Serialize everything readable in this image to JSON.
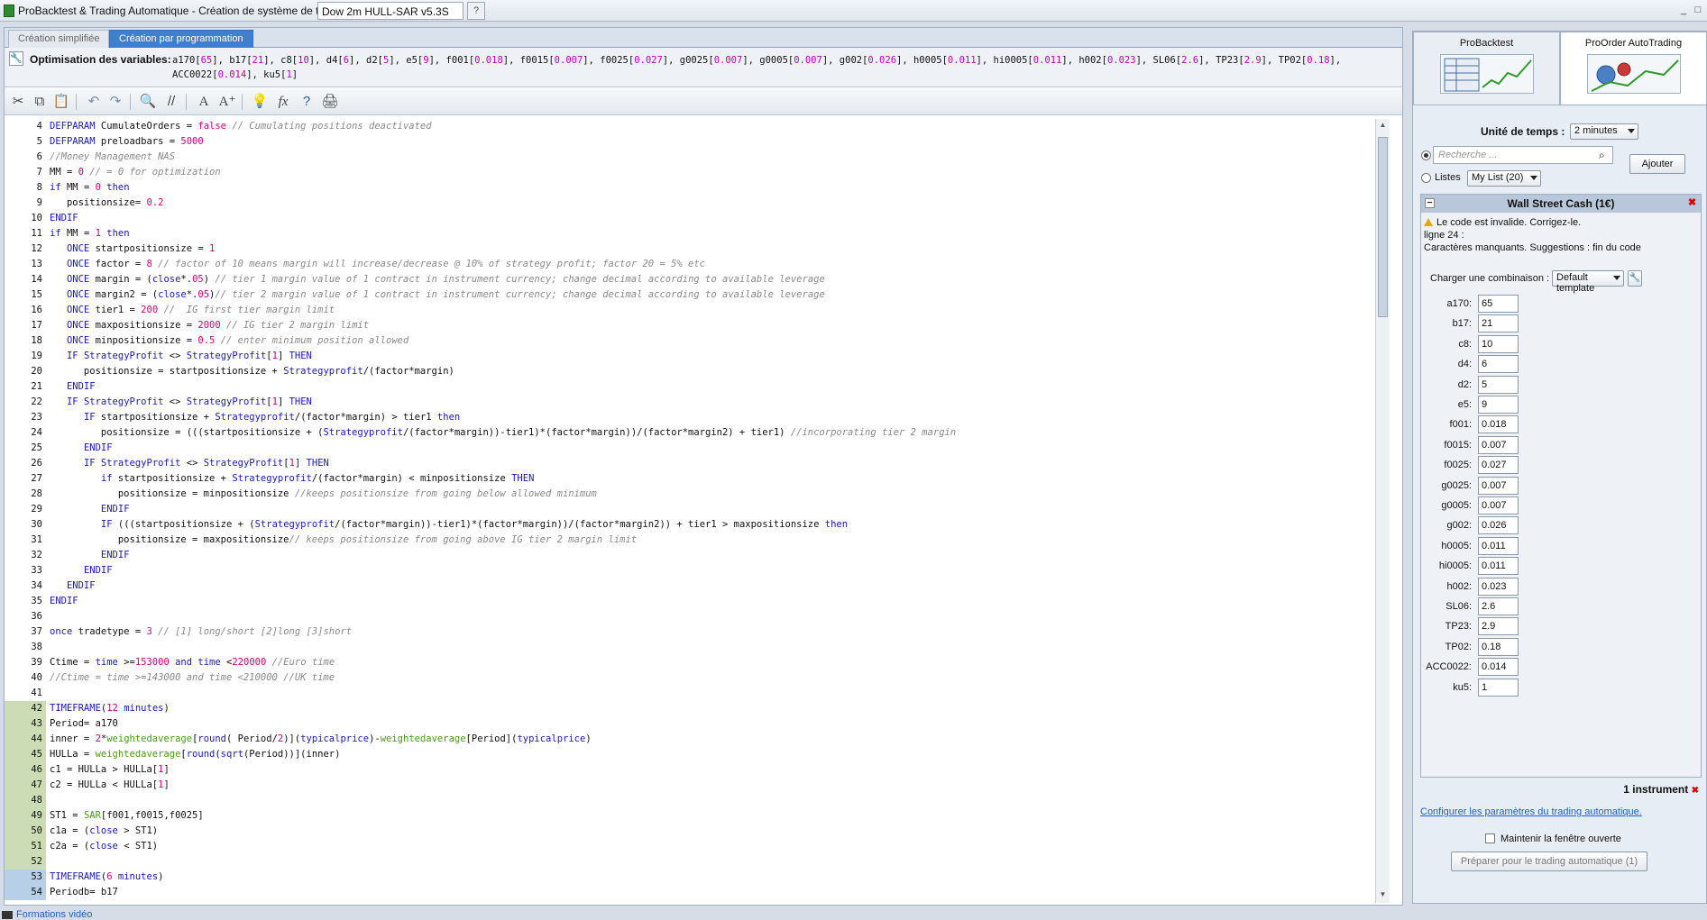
{
  "window": {
    "title": "ProBacktest & Trading Automatique - Création de système de trading",
    "doc_name": "Dow 2m HULL-SAR v5.3S",
    "help": "?"
  },
  "tabs": [
    "Création simplifiée",
    "Création par programmation"
  ],
  "optimisation": {
    "label": "Optimisation des variables:",
    "vars": [
      {
        "n": "a170",
        "v": "65"
      },
      {
        "n": "b17",
        "v": "21"
      },
      {
        "n": "c8",
        "v": "10"
      },
      {
        "n": "d4",
        "v": "6"
      },
      {
        "n": "d2",
        "v": "5"
      },
      {
        "n": "e5",
        "v": "9"
      },
      {
        "n": "f001",
        "v": "0.018"
      },
      {
        "n": "f0015",
        "v": "0.007"
      },
      {
        "n": "f0025",
        "v": "0.027"
      },
      {
        "n": "g0025",
        "v": "0.007"
      },
      {
        "n": "g0005",
        "v": "0.007"
      },
      {
        "n": "g002",
        "v": "0.026"
      },
      {
        "n": "h0005",
        "v": "0.011"
      },
      {
        "n": "hi0005",
        "v": "0.011"
      },
      {
        "n": "h002",
        "v": "0.023"
      },
      {
        "n": "SL06",
        "v": "2.6"
      },
      {
        "n": "TP23",
        "v": "2.9"
      },
      {
        "n": "TP02",
        "v": "0.18"
      },
      {
        "n": "ACC0022",
        "v": "0.014"
      },
      {
        "n": "ku5",
        "v": "1"
      }
    ]
  },
  "toolbar": [
    "cut-icon",
    "copy-icon",
    "paste-icon",
    "undo-icon",
    "redo-icon",
    "find-icon",
    "comment-icon",
    "font-size-icon",
    "font-increase-icon",
    "lightbulb-icon",
    "function-icon",
    "help-icon",
    "print-icon"
  ],
  "code_lines": [
    {
      "n": "4",
      "c": "<span class=\"kw\">DEFPARAM</span> CumulateOrders = <span class=\"num\">false</span> <span class=\"cm\">// Cumulating positions deactivated</span>"
    },
    {
      "n": "5",
      "c": "<span class=\"kw\">DEFPARAM</span> preloadbars = <span class=\"num\">5000</span>"
    },
    {
      "n": "6",
      "c": "<span class=\"cm\">//Money Management NAS</span>"
    },
    {
      "n": "7",
      "c": "MM = <span class=\"num\">0</span> <span class=\"cm\">// = 0 for optimization</span>"
    },
    {
      "n": "8",
      "c": "<span class=\"kw\">if</span> MM = <span class=\"num\">0</span> <span class=\"kw\">then</span>"
    },
    {
      "n": "9",
      "c": "   positionsize= <span class=\"num\">0.2</span>"
    },
    {
      "n": "10",
      "c": "<span class=\"kw\">ENDIF</span>"
    },
    {
      "n": "11",
      "c": "<span class=\"kw\">if</span> MM = <span class=\"num\">1</span> <span class=\"kw\">then</span>"
    },
    {
      "n": "12",
      "c": "   <span class=\"kw\">ONCE</span> startpositionsize = <span class=\"num\">1</span>"
    },
    {
      "n": "13",
      "c": "   <span class=\"kw\">ONCE</span> factor = <span class=\"num\">8</span> <span class=\"cm\">// factor of 10 means margin will increase/decrease @ 10% of strategy profit; factor 20 = 5% etc</span>"
    },
    {
      "n": "14",
      "c": "   <span class=\"kw\">ONCE</span> margin = (<span class=\"kw\">close</span>*.<span class=\"num\">05</span>) <span class=\"cm\">// tier 1 margin value of 1 contract in instrument currency; change decimal according to available leverage</span>"
    },
    {
      "n": "15",
      "c": "   <span class=\"kw\">ONCE</span> margin2 = (<span class=\"kw\">close</span>*.<span class=\"num\">05</span>)<span class=\"cm\">// tier 2 margin value of 1 contract in instrument currency; change decimal according to available leverage</span>"
    },
    {
      "n": "16",
      "c": "   <span class=\"kw\">ONCE</span> tier1 = <span class=\"num\">200</span> <span class=\"cm\">//  IG first tier margin limit</span>"
    },
    {
      "n": "17",
      "c": "   <span class=\"kw\">ONCE</span> maxpositionsize = <span class=\"num\">2000</span> <span class=\"cm\">// IG tier 2 margin limit</span>"
    },
    {
      "n": "18",
      "c": "   <span class=\"kw\">ONCE</span> minpositionsize = <span class=\"num\">0.5</span> <span class=\"cm\">// enter minimum position allowed</span>"
    },
    {
      "n": "19",
      "c": "   <span class=\"kw\">IF</span> <span class=\"kw\">StrategyProfit</span> &lt;&gt; <span class=\"kw\">StrategyProfit</span>[<span class=\"num\">1</span>] <span class=\"kw\">THEN</span>"
    },
    {
      "n": "20",
      "c": "      positionsize = startpositionsize + <span class=\"kw\">Strategyprofit</span>/(factor*margin)"
    },
    {
      "n": "21",
      "c": "   <span class=\"kw\">ENDIF</span>"
    },
    {
      "n": "22",
      "c": "   <span class=\"kw\">IF</span> <span class=\"kw\">StrategyProfit</span> &lt;&gt; <span class=\"kw\">StrategyProfit</span>[<span class=\"num\">1</span>] <span class=\"kw\">THEN</span>"
    },
    {
      "n": "23",
      "c": "      <span class=\"kw\">IF</span> startpositionsize + <span class=\"kw\">Strategyprofit</span>/(factor*margin) &gt; tier1 <span class=\"kw\">then</span>"
    },
    {
      "n": "24",
      "c": "         positionsize = (((startpositionsize + (<span class=\"kw\">Strategyprofit</span>/(factor*margin))-tier1)*(factor*margin))/(factor*margin2) + tier1) <span class=\"cm\">//incorporating tier 2 margin</span>"
    },
    {
      "n": "25",
      "c": "      <span class=\"kw\">ENDIF</span>"
    },
    {
      "n": "26",
      "c": "      <span class=\"kw\">IF</span> <span class=\"kw\">StrategyProfit</span> &lt;&gt; <span class=\"kw\">StrategyProfit</span>[<span class=\"num\">1</span>] <span class=\"kw\">THEN</span>"
    },
    {
      "n": "27",
      "c": "         <span class=\"kw\">if</span> startpositionsize + <span class=\"kw\">Strategyprofit</span>/(factor*margin) &lt; minpositionsize <span class=\"kw\">THEN</span>"
    },
    {
      "n": "28",
      "c": "            positionsize = minpositionsize <span class=\"cm\">//keeps positionsize from going below allowed minimum</span>"
    },
    {
      "n": "29",
      "c": "         <span class=\"kw\">ENDIF</span>"
    },
    {
      "n": "30",
      "c": "         <span class=\"kw\">IF</span> (((startpositionsize + (<span class=\"kw\">Strategyprofit</span>/(factor*margin))-tier1)*(factor*margin))/(factor*margin2)) + tier1 &gt; maxpositionsize <span class=\"kw\">then</span>"
    },
    {
      "n": "31",
      "c": "            positionsize = maxpositionsize<span class=\"cm\">// keeps positionsize from going above IG tier 2 margin limit</span>"
    },
    {
      "n": "32",
      "c": "         <span class=\"kw\">ENDIF</span>"
    },
    {
      "n": "33",
      "c": "      <span class=\"kw\">ENDIF</span>"
    },
    {
      "n": "34",
      "c": "   <span class=\"kw\">ENDIF</span>"
    },
    {
      "n": "35",
      "c": "<span class=\"kw\">ENDIF</span>"
    },
    {
      "n": "36",
      "c": ""
    },
    {
      "n": "37",
      "c": "<span class=\"kw\">once</span> tradetype = <span class=\"num\">3</span> <span class=\"cm\">// [1] long/short [2]long [3]short</span>"
    },
    {
      "n": "38",
      "c": ""
    },
    {
      "n": "39",
      "c": "Ctime = <span class=\"kw\">time</span> &gt;=<span class=\"num\">153000</span> <span class=\"kw\">and</span> <span class=\"kw\">time</span> &lt;<span class=\"num\">220000</span> <span class=\"cm\">//Euro time</span>"
    },
    {
      "n": "40",
      "c": "<span class=\"cm\">//Ctime = time &gt;=143000 and time &lt;210000 //UK time</span>"
    },
    {
      "n": "41",
      "c": ""
    },
    {
      "n": "42",
      "c": "<span class=\"kw\">TIMEFRAME</span>(<span class=\"num\">12</span> <span class=\"kw\">minutes</span>)",
      "hl": "hl"
    },
    {
      "n": "43",
      "c": "Period= a170",
      "hl": "hl"
    },
    {
      "n": "44",
      "c": "inner = <span class=\"num\">2</span>*<span class=\"fn\">weightedaverage</span>[<span class=\"kw\">round</span>( Period/<span class=\"num\">2</span>)](<span class=\"kw\">typicalprice</span>)-<span class=\"fn\">weightedaverage</span>[Period](<span class=\"kw\">typicalprice</span>)",
      "hl": "hl"
    },
    {
      "n": "45",
      "c": "HULLa = <span class=\"fn\">weightedaverage</span>[<span class=\"kw\">round</span>(<span class=\"kw\">sqrt</span>(Period))](inner)",
      "hl": "hl"
    },
    {
      "n": "46",
      "c": "c1 = HULLa &gt; HULLa[<span class=\"num\">1</span>]",
      "hl": "hl"
    },
    {
      "n": "47",
      "c": "c2 = HULLa &lt; HULLa[<span class=\"num\">1</span>]",
      "hl": "hl"
    },
    {
      "n": "48",
      "c": "",
      "hl": "hl"
    },
    {
      "n": "49",
      "c": "ST1 = <span class=\"fn\">SAR</span>[f001,f0015,f0025]",
      "hl": "hl"
    },
    {
      "n": "50",
      "c": "c1a = (<span class=\"kw\">close</span> &gt; ST1)",
      "hl": "hl"
    },
    {
      "n": "51",
      "c": "c2a = (<span class=\"kw\">close</span> &lt; ST1)",
      "hl": "hl"
    },
    {
      "n": "52",
      "c": "",
      "hl": "hl"
    },
    {
      "n": "53",
      "c": "<span class=\"kw\">TIMEFRAME</span>(<span class=\"num\">6</span> <span class=\"kw\">minutes</span>)",
      "hl": "hl2"
    },
    {
      "n": "54",
      "c": "Periodb= b17",
      "hl": "hl2"
    }
  ],
  "right_tabs": [
    "ProBacktest",
    "ProOrder AutoTrading"
  ],
  "panel": {
    "unite_label": "Unité de temps :",
    "unite_value": "2 minutes",
    "search_placeholder": "Recherche ...",
    "listes_label": "Listes",
    "list_value": "My List (20)",
    "ajouter": "Ajouter",
    "instrument": "Wall Street Cash (1€)",
    "msg1": "Le code est invalide. Corrigez-le.",
    "msg2": "ligne 24 :",
    "msg3": "Caractères manquants. Suggestions : fin du code",
    "charger_label": "Charger une combinaison :",
    "charger_value": "Default template",
    "params": [
      {
        "l": "a170:",
        "v": "65"
      },
      {
        "l": "b17:",
        "v": "21"
      },
      {
        "l": "c8:",
        "v": "10"
      },
      {
        "l": "d4:",
        "v": "6"
      },
      {
        "l": "d2:",
        "v": "5"
      },
      {
        "l": "e5:",
        "v": "9"
      },
      {
        "l": "f001:",
        "v": "0.018"
      },
      {
        "l": "f0015:",
        "v": "0.007"
      },
      {
        "l": "f0025:",
        "v": "0.027"
      },
      {
        "l": "g0025:",
        "v": "0.007"
      },
      {
        "l": "g0005:",
        "v": "0.007"
      },
      {
        "l": "g002:",
        "v": "0.026"
      },
      {
        "l": "h0005:",
        "v": "0.011"
      },
      {
        "l": "hi0005:",
        "v": "0.011"
      },
      {
        "l": "h002:",
        "v": "0.023"
      },
      {
        "l": "SL06:",
        "v": "2.6"
      },
      {
        "l": "TP23:",
        "v": "2.9"
      },
      {
        "l": "TP02:",
        "v": "0.18"
      },
      {
        "l": "ACC0022:",
        "v": "0.014"
      },
      {
        "l": "ku5:",
        "v": "1"
      }
    ],
    "instrument_count": "1 instrument",
    "config_link": "Configurer les paramètres du trading automatique.",
    "maintenir": "Maintenir la fenêtre ouverte",
    "preparer": "Préparer pour le trading automatique (1)"
  },
  "bottom": {
    "formations": "Formations vidéo"
  }
}
